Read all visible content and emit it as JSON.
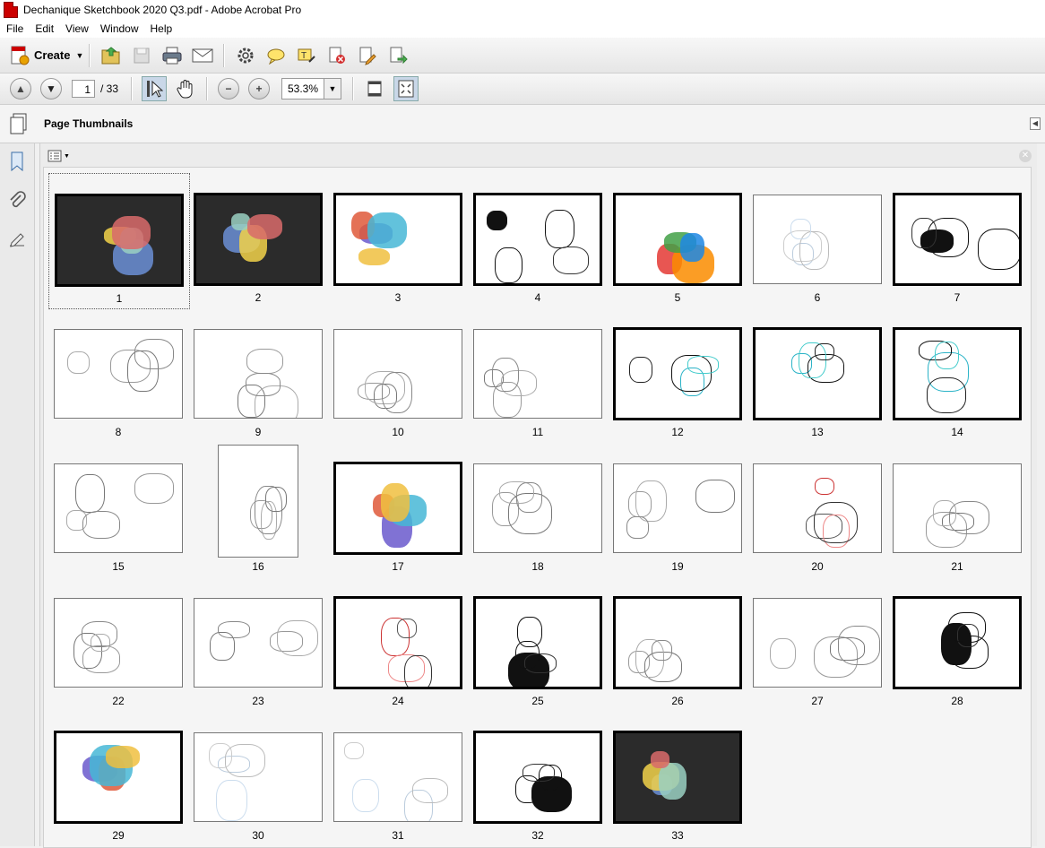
{
  "window": {
    "title": "Dechanique Sketchbook 2020 Q3.pdf - Adobe Acrobat Pro"
  },
  "menu": [
    "File",
    "Edit",
    "View",
    "Window",
    "Help"
  ],
  "toolbar": {
    "create_label": "Create",
    "icons": [
      "open-icon",
      "save-icon",
      "print-icon",
      "email-icon",
      "settings-icon",
      "comment-icon",
      "highlight-icon",
      "delete-pages-icon",
      "edit-icon",
      "export-icon"
    ]
  },
  "nav": {
    "current_page": "1",
    "page_total": "/ 33",
    "zoom": "53.3%"
  },
  "panel": {
    "title": "Page Thumbnails"
  },
  "thumbnails": {
    "selected": "1",
    "pages": [
      {
        "n": "1",
        "style": "dark"
      },
      {
        "n": "2",
        "style": "dark"
      },
      {
        "n": "3",
        "style": "color"
      },
      {
        "n": "4",
        "style": "ink"
      },
      {
        "n": "5",
        "style": "swatch"
      },
      {
        "n": "6",
        "style": "light"
      },
      {
        "n": "7",
        "style": "ink"
      },
      {
        "n": "8",
        "style": "sketch"
      },
      {
        "n": "9",
        "style": "sketch"
      },
      {
        "n": "10",
        "style": "sketch"
      },
      {
        "n": "11",
        "style": "sketch"
      },
      {
        "n": "12",
        "style": "cyan"
      },
      {
        "n": "13",
        "style": "cyan"
      },
      {
        "n": "14",
        "style": "cyan"
      },
      {
        "n": "15",
        "style": "sketch"
      },
      {
        "n": "16",
        "style": "portrait"
      },
      {
        "n": "17",
        "style": "color"
      },
      {
        "n": "18",
        "style": "sketch"
      },
      {
        "n": "19",
        "style": "sketch"
      },
      {
        "n": "20",
        "style": "red"
      },
      {
        "n": "21",
        "style": "sketch"
      },
      {
        "n": "22",
        "style": "sketch"
      },
      {
        "n": "23",
        "style": "sketch"
      },
      {
        "n": "24",
        "style": "red"
      },
      {
        "n": "25",
        "style": "ink"
      },
      {
        "n": "26",
        "style": "sketch"
      },
      {
        "n": "27",
        "style": "sketch"
      },
      {
        "n": "28",
        "style": "ink"
      },
      {
        "n": "29",
        "style": "color"
      },
      {
        "n": "30",
        "style": "light"
      },
      {
        "n": "31",
        "style": "light"
      },
      {
        "n": "32",
        "style": "ink"
      },
      {
        "n": "33",
        "style": "dark"
      }
    ]
  }
}
